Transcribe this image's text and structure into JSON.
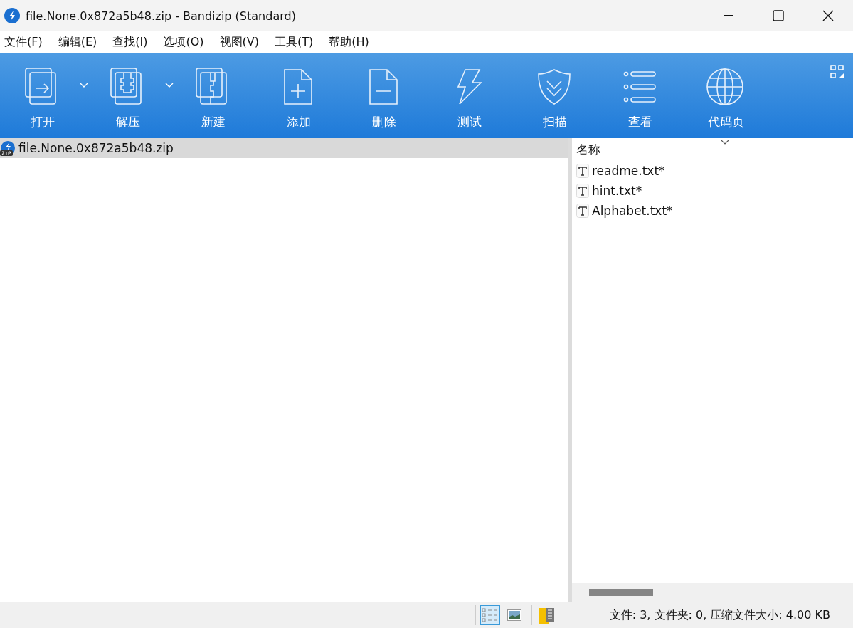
{
  "window": {
    "title": "file.None.0x872a5b48.zip - Bandizip (Standard)"
  },
  "menu": [
    "文件(F)",
    "编辑(E)",
    "查找(I)",
    "选项(O)",
    "视图(V)",
    "工具(T)",
    "帮助(H)"
  ],
  "toolbar": [
    {
      "kind": "open",
      "label": "打开",
      "dropdown": true
    },
    {
      "kind": "extract",
      "label": "解压",
      "dropdown": true
    },
    {
      "kind": "new",
      "label": "新建",
      "dropdown": false
    },
    {
      "kind": "add",
      "label": "添加",
      "dropdown": false
    },
    {
      "kind": "delete",
      "label": "删除",
      "dropdown": false
    },
    {
      "kind": "test",
      "label": "测试",
      "dropdown": false
    },
    {
      "kind": "scan",
      "label": "扫描",
      "dropdown": false
    },
    {
      "kind": "view",
      "label": "查看",
      "dropdown": false
    },
    {
      "kind": "codepage",
      "label": "代码页",
      "dropdown": true
    }
  ],
  "tree": [
    {
      "label": "file.None.0x872a5b48.zip",
      "selected": true
    }
  ],
  "file_list": {
    "column": "名称",
    "rows": [
      {
        "name": "readme.txt*",
        "selected": false
      },
      {
        "name": "hint.txt*",
        "selected": false
      },
      {
        "name": "Alphabet.txt*",
        "selected": false
      }
    ]
  },
  "status_bar": {
    "text": "文件: 3, 文件夹: 0, 压缩文件大小: 4.00 KB"
  }
}
